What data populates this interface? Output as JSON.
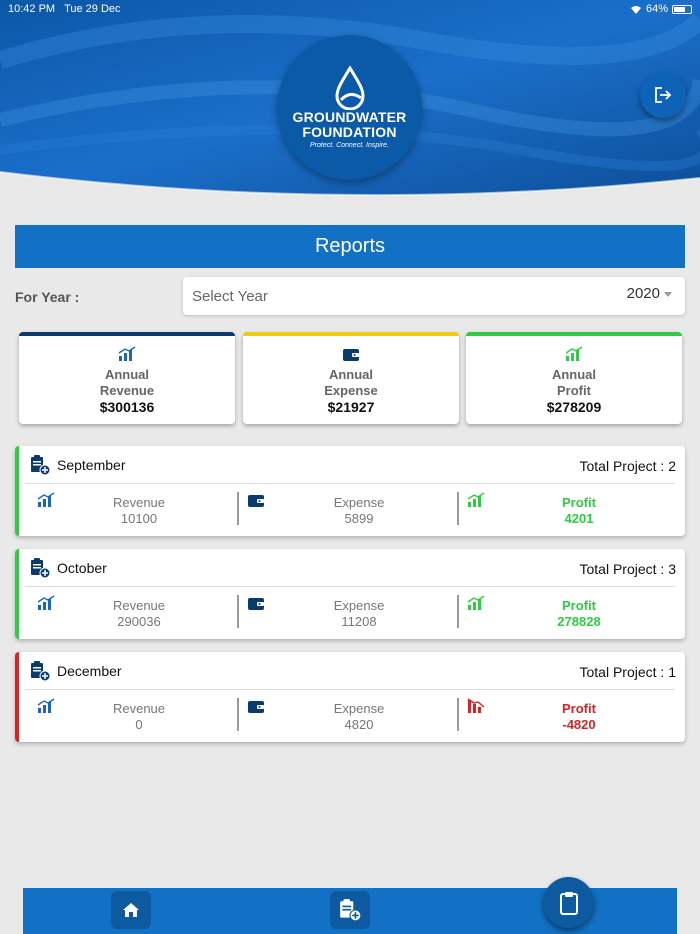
{
  "status_bar": {
    "time": "10:42 PM",
    "date": "Tue 29 Dec",
    "battery": "64%"
  },
  "logo": {
    "line1": "GROUNDWATER",
    "line2": "FOUNDATION",
    "tagline": "Protect. Connect. Inspire."
  },
  "reports_title": "Reports",
  "year_filter": {
    "label": "For Year :",
    "placeholder": "Select Year",
    "value": "2020"
  },
  "summary": [
    {
      "line1": "Annual",
      "line2": "Revenue",
      "value": "$300136",
      "icon": "revenue-chart-icon",
      "accent": "#0b3a6e"
    },
    {
      "line1": "Annual",
      "line2": "Expense",
      "value": "$21927",
      "icon": "wallet-icon",
      "accent": "#f2cc0c"
    },
    {
      "line1": "Annual",
      "line2": "Profit",
      "value": "$278209",
      "icon": "profit-chart-icon",
      "accent": "#2ecc40"
    }
  ],
  "months": [
    {
      "name": "September",
      "total_project": "Total Project : 2",
      "revenue_label": "Revenue",
      "revenue": "10100",
      "expense_label": "Expense",
      "expense": "5899",
      "profit_label": "Profit",
      "profit": "4201",
      "status_color": "#2ecc40"
    },
    {
      "name": "October",
      "total_project": "Total Project : 3",
      "revenue_label": "Revenue",
      "revenue": "290036",
      "expense_label": "Expense",
      "expense": "11208",
      "profit_label": "Profit",
      "profit": "278828",
      "status_color": "#2ecc40"
    },
    {
      "name": "December",
      "total_project": "Total Project : 1",
      "revenue_label": "Revenue",
      "revenue": "0",
      "expense_label": "Expense",
      "expense": "4820",
      "profit_label": "Profit",
      "profit": "-4820",
      "status_color": "#e02020"
    }
  ],
  "bottom_nav": {
    "home_icon": "home-icon",
    "add_project_icon": "add-project-icon",
    "reports_icon": "clipboard-icon"
  }
}
